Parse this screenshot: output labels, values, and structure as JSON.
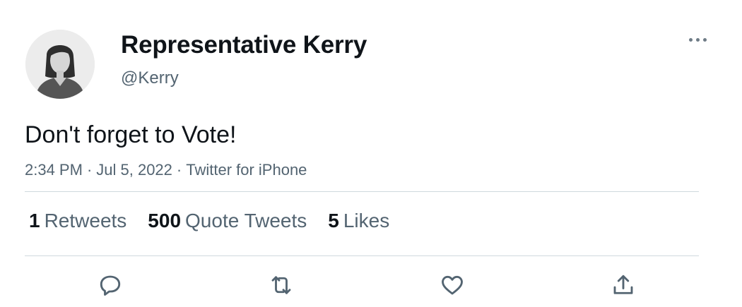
{
  "user": {
    "display_name": "Representative Kerry",
    "handle": "@Kerry",
    "avatar_icon": "default-female-avatar"
  },
  "tweet": {
    "text": "Don't forget to Vote!",
    "time": "2:34 PM",
    "date": "Jul 5, 2022",
    "source": "Twitter for iPhone",
    "separator": "·"
  },
  "stats": [
    {
      "count": "1",
      "label": "Retweets"
    },
    {
      "count": "500",
      "label": "Quote Tweets"
    },
    {
      "count": "5",
      "label": "Likes"
    }
  ],
  "actions": {
    "reply_icon": "speech-bubble-icon",
    "retweet_icon": "retweet-arrows-icon",
    "like_icon": "heart-icon",
    "share_icon": "share-upload-icon",
    "more_icon": "ellipsis-icon"
  },
  "colors": {
    "text_primary": "#0f1419",
    "text_secondary": "#536471",
    "divider": "#cfd9de"
  }
}
